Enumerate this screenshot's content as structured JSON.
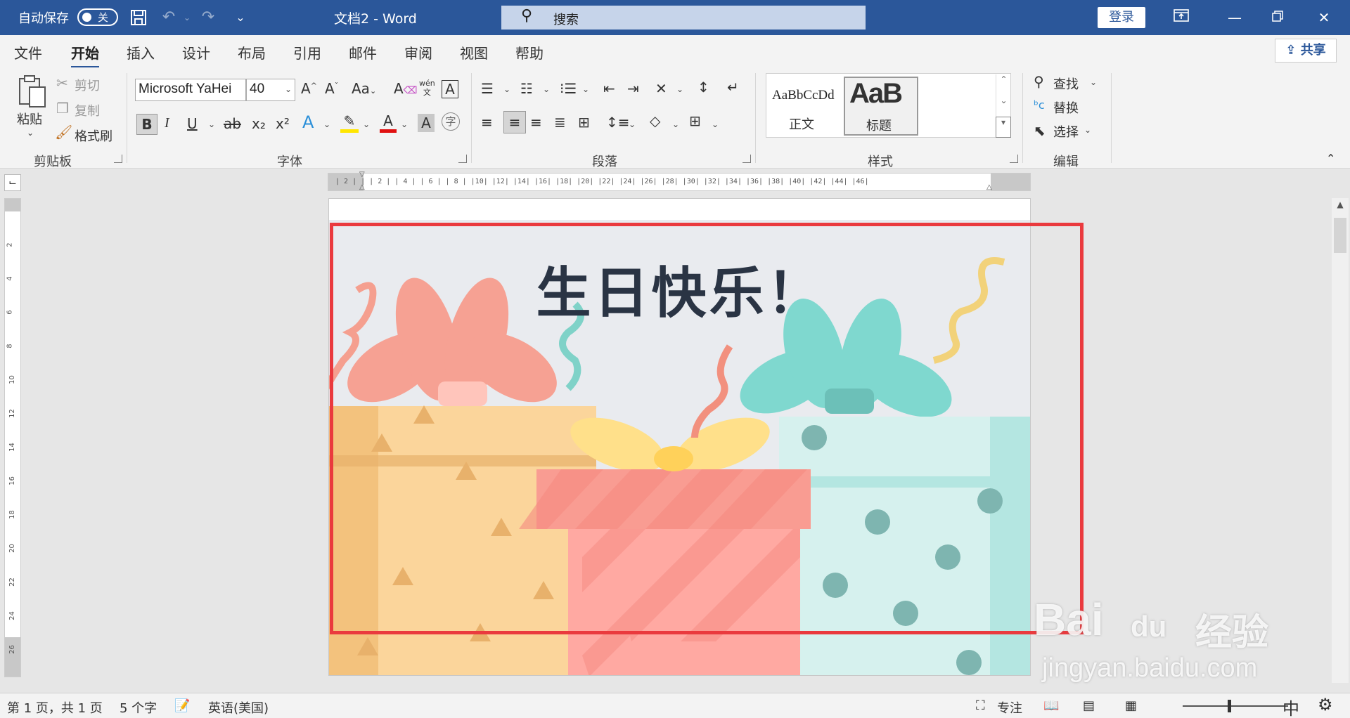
{
  "titlebar": {
    "autosave_label": "自动保存",
    "autosave_state": "关",
    "doc_title": "文档2  -  Word",
    "search_placeholder": "搜索",
    "login_label": "登录"
  },
  "tabs": [
    "文件",
    "开始",
    "插入",
    "设计",
    "布局",
    "引用",
    "邮件",
    "审阅",
    "视图",
    "帮助"
  ],
  "active_tab": "开始",
  "share_label": "共享",
  "clipboard": {
    "paste": "粘贴",
    "cut": "剪切",
    "copy": "复制",
    "format_painter": "格式刷",
    "group": "剪贴板"
  },
  "font": {
    "family": "Microsoft YaHei",
    "size": "40",
    "group": "字体",
    "case_label": "Aa",
    "phonetic_top": "wén",
    "phonetic_bottom": "文",
    "border_char": "A",
    "bold": "B",
    "italic": "I",
    "underline": "U",
    "strike": "ab",
    "subscript": "x₂",
    "superscript": "x²",
    "effects": "A",
    "font_color": "A",
    "shading": "A",
    "enclose": "字"
  },
  "paragraph": {
    "group": "段落"
  },
  "styles": {
    "group": "样式",
    "items": [
      {
        "preview": "AaBbCcDd",
        "name": "正文"
      },
      {
        "preview": "AaB",
        "name": "标题"
      }
    ]
  },
  "editing": {
    "group": "编辑",
    "find": "查找",
    "replace": "替换",
    "select": "选择"
  },
  "ruler": {
    "horizontal": "| 2 |     |   | 2 |   | 4 |   | 6 |   | 8 |   |10|   |12|   |14|   |16|   |18|   |20|   |22|   |24|   |26|   |28|   |30|   |32|   |34|   |36|   |38|   |40|   |42|   |44|   |46|",
    "vertical": [
      "2",
      "4",
      "6",
      "8",
      "10",
      "12",
      "14",
      "16",
      "18",
      "20",
      "22",
      "24",
      "26"
    ]
  },
  "document": {
    "heading": "生日快乐！"
  },
  "statusbar": {
    "page": "第 1 页，共 1 页",
    "words": "5 个字",
    "language": "英语(美国)",
    "focus": "专注",
    "ime": "中"
  },
  "watermark": {
    "logo": "Bai",
    "du": "du",
    "cn": "经验",
    "url": "jingyan.baidu.com"
  },
  "colors": {
    "brand": "#2b579a",
    "selection": "#ea3a3e",
    "heading": "#2a3444"
  }
}
